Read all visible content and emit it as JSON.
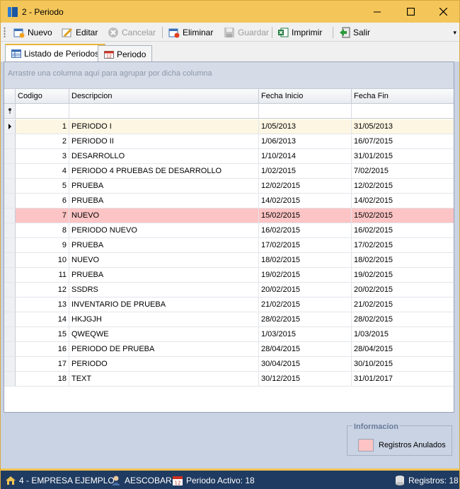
{
  "window": {
    "title": "2 - Periodo"
  },
  "toolbar": {
    "nuevo": "Nuevo",
    "editar": "Editar",
    "cancelar": "Cancelar",
    "eliminar": "Eliminar",
    "guardar": "Guardar",
    "imprimir": "Imprimir",
    "salir": "Salir"
  },
  "tabs": [
    {
      "label": "Listado de Periodos"
    },
    {
      "label": "Periodo"
    }
  ],
  "grid": {
    "group_hint": "Arrastre una columna aquí para agrupar por dicha columna",
    "columns": [
      "Codigo",
      "Descripcion",
      "Fecha Inicio",
      "Fecha Fin"
    ],
    "rows": [
      {
        "codigo": "1",
        "descripcion": "PERIODO I",
        "inicio": "1/05/2013",
        "fin": "31/05/2013",
        "state": "selected"
      },
      {
        "codigo": "2",
        "descripcion": "PERIODO II",
        "inicio": "1/06/2013",
        "fin": "16/07/2015",
        "state": ""
      },
      {
        "codigo": "3",
        "descripcion": "DESARROLLO",
        "inicio": "1/10/2014",
        "fin": "31/01/2015",
        "state": ""
      },
      {
        "codigo": "4",
        "descripcion": "PERIODO 4 PRUEBAS DE DESARROLLO",
        "inicio": "1/02/2015",
        "fin": "7/02/2015",
        "state": ""
      },
      {
        "codigo": "5",
        "descripcion": "PRUEBA",
        "inicio": "12/02/2015",
        "fin": "12/02/2015",
        "state": ""
      },
      {
        "codigo": "6",
        "descripcion": "PRUEBA",
        "inicio": "14/02/2015",
        "fin": "14/02/2015",
        "state": ""
      },
      {
        "codigo": "7",
        "descripcion": "NUEVO",
        "inicio": "15/02/2015",
        "fin": "15/02/2015",
        "state": "anulado"
      },
      {
        "codigo": "8",
        "descripcion": "PERIODO NUEVO",
        "inicio": "16/02/2015",
        "fin": "16/02/2015",
        "state": ""
      },
      {
        "codigo": "9",
        "descripcion": "PRUEBA",
        "inicio": "17/02/2015",
        "fin": "17/02/2015",
        "state": ""
      },
      {
        "codigo": "10",
        "descripcion": "NUEVO",
        "inicio": "18/02/2015",
        "fin": "18/02/2015",
        "state": ""
      },
      {
        "codigo": "11",
        "descripcion": "PRUEBA",
        "inicio": "19/02/2015",
        "fin": "19/02/2015",
        "state": ""
      },
      {
        "codigo": "12",
        "descripcion": "SSDRS",
        "inicio": "20/02/2015",
        "fin": "20/02/2015",
        "state": ""
      },
      {
        "codigo": "13",
        "descripcion": "INVENTARIO DE PRUEBA",
        "inicio": "21/02/2015",
        "fin": "21/02/2015",
        "state": ""
      },
      {
        "codigo": "14",
        "descripcion": "HKJGJH",
        "inicio": "28/02/2015",
        "fin": "28/02/2015",
        "state": ""
      },
      {
        "codigo": "15",
        "descripcion": "QWEQWE",
        "inicio": "1/03/2015",
        "fin": "1/03/2015",
        "state": ""
      },
      {
        "codigo": "16",
        "descripcion": "PERIODO DE PRUEBA",
        "inicio": "28/04/2015",
        "fin": "28/04/2015",
        "state": ""
      },
      {
        "codigo": "17",
        "descripcion": "PERIODO",
        "inicio": "30/04/2015",
        "fin": "30/10/2015",
        "state": ""
      },
      {
        "codigo": "18",
        "descripcion": "TEXT",
        "inicio": "30/12/2015",
        "fin": "31/01/2017",
        "state": ""
      }
    ]
  },
  "info": {
    "title": "Informacion",
    "legend": "Registros Anulados"
  },
  "statusbar": {
    "empresa": "4 - EMPRESA EJEMPLO",
    "usuario": "AESCOBAR",
    "periodo": "Periodo Activo: 18",
    "registros": "Registros: 18"
  },
  "colors": {
    "anulado": "#fcc4c4",
    "selected": "#fdf6e3",
    "accent": "#f4c659",
    "statusbar": "#1f3b61"
  }
}
